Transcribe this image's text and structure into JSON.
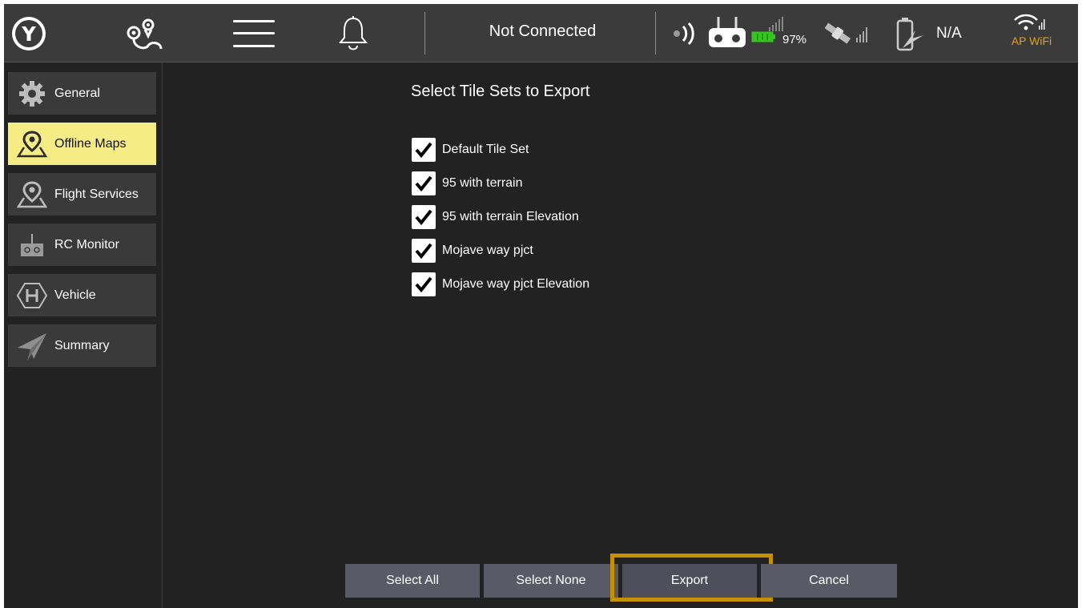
{
  "toolbar": {
    "status": "Not Connected",
    "rc_battery_pct": "97%",
    "vehicle_battery": "N/A",
    "wifi_label": "AP WiFi",
    "colors": {
      "background": "#3b3b3b",
      "wifi_label": "#e0a21b",
      "rc_battery": "#35c420"
    },
    "icons": [
      "app-logo-icon",
      "plan-route-icon",
      "menu-icon",
      "bell-icon",
      "telemetry-signal-icon",
      "rc-controller-icon",
      "rc-battery-icon",
      "gps-icon",
      "vehicle-battery-icon",
      "wifi-icon"
    ]
  },
  "sidebar": {
    "items": [
      {
        "label": "General",
        "icon": "gear-icon",
        "active": false
      },
      {
        "label": "Offline Maps",
        "icon": "map-pin-icon",
        "active": true
      },
      {
        "label": "Flight Services",
        "icon": "map-pin-icon",
        "active": false
      },
      {
        "label": "RC Monitor",
        "icon": "rc-controller-icon",
        "active": false
      },
      {
        "label": "Vehicle",
        "icon": "hexagon-h-icon",
        "active": false
      },
      {
        "label": "Summary",
        "icon": "paper-plane-icon",
        "active": false
      }
    ],
    "active_color": "#f6ec85"
  },
  "main": {
    "title": "Select Tile Sets to Export",
    "tile_sets": [
      {
        "label": "Default Tile Set",
        "checked": true
      },
      {
        "label": "95 with terrain",
        "checked": true
      },
      {
        "label": "95 with terrain Elevation",
        "checked": true
      },
      {
        "label": "Mojave way pjct",
        "checked": true
      },
      {
        "label": "Mojave way pjct Elevation",
        "checked": true
      }
    ],
    "buttons": {
      "select_all": "Select All",
      "select_none": "Select None",
      "export": "Export",
      "cancel": "Cancel"
    },
    "highlight_color": "#c59100"
  }
}
